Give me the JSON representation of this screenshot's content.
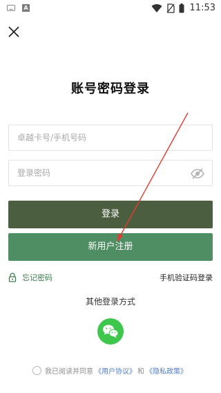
{
  "status_bar": {
    "time": "11:53",
    "left_icons": [
      "keyboard-icon",
      "a-notification-icon"
    ],
    "right_icons": [
      "wifi-icon",
      "no-sim-icon",
      "battery-icon"
    ]
  },
  "header": {
    "close_icon": "close-icon",
    "title": "账号密码登录"
  },
  "form": {
    "account_placeholder": "卓越卡号/手机号码",
    "password_placeholder": "登录密码",
    "eye_icon": "eye-off-icon",
    "login_label": "登录",
    "register_label": "新用户注册"
  },
  "links": {
    "forgot_label": "忘记密码",
    "sms_login_label": "手机验证码登录"
  },
  "other": {
    "label": "其他登录方式",
    "wechat_icon": "wechat-icon"
  },
  "agreement": {
    "prefix": "我已阅读并同意",
    "user_agreement": "《用户协议》",
    "and": "和",
    "privacy_policy": "《隐私政策》"
  },
  "colors": {
    "login_button": "#4b5e3f",
    "register_button": "#4f8d63",
    "accent_green": "#3c7a4c",
    "wechat": "#3ec74c",
    "link": "#4f7cc9",
    "arrow": "#e23b32"
  }
}
